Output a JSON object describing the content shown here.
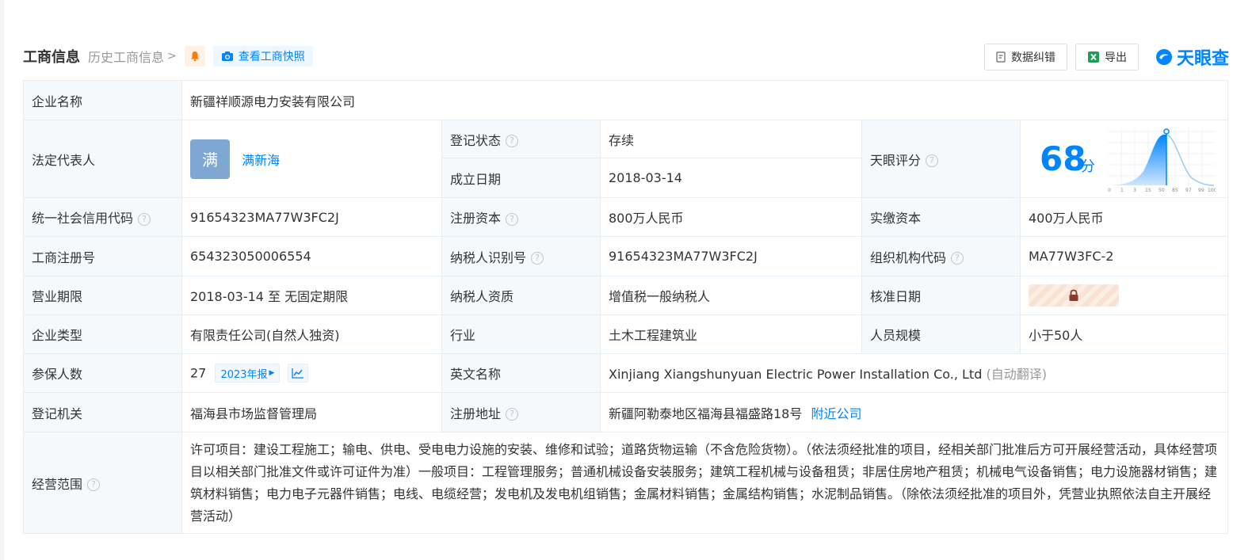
{
  "header": {
    "title": "工商信息",
    "history_label": "历史工商信息",
    "snapshot_label": "查看工商快照",
    "correct_label": "数据纠错",
    "export_label": "导出",
    "brand": "天眼查"
  },
  "rows": {
    "company_name": {
      "label": "企业名称",
      "value": "新疆祥顺源电力安装有限公司"
    },
    "legal_rep": {
      "label": "法定代表人",
      "avatar_char": "满",
      "name": "满新海"
    },
    "reg_status": {
      "label": "登记状态",
      "value": "存续"
    },
    "found_date": {
      "label": "成立日期",
      "value": "2018-03-14"
    },
    "tianyan_score": {
      "label": "天眼评分",
      "score": "68",
      "unit": "分",
      "value": 68,
      "axis_ticks": [
        "0",
        "1",
        "3",
        "15",
        "50",
        "85",
        "97",
        "99",
        "100"
      ]
    },
    "credit_code": {
      "label": "统一社会信用代码",
      "value": "91654323MA77W3FC2J"
    },
    "reg_capital": {
      "label": "注册资本",
      "value": "800万人民币"
    },
    "paid_capital": {
      "label": "实缴资本",
      "value": "400万人民币"
    },
    "reg_number": {
      "label": "工商注册号",
      "value": "654323050006554"
    },
    "taxpayer_id": {
      "label": "纳税人识别号",
      "value": "91654323MA77W3FC2J"
    },
    "org_code": {
      "label": "组织机构代码",
      "value": "MA77W3FC-2"
    },
    "term": {
      "label": "营业期限",
      "value": "2018-03-14 至 无固定期限"
    },
    "taxpayer_qual": {
      "label": "纳税人资质",
      "value": "增值税一般纳税人"
    },
    "approve_date": {
      "label": "核准日期"
    },
    "company_type": {
      "label": "企业类型",
      "value": "有限责任公司(自然人独资)"
    },
    "industry": {
      "label": "行业",
      "value": "土木工程建筑业"
    },
    "staff_size": {
      "label": "人员规模",
      "value": "小于50人"
    },
    "insured": {
      "label": "参保人数",
      "value": "27",
      "report": "2023年报"
    },
    "english_name": {
      "label": "英文名称",
      "value": "Xinjiang Xiangshunyuan Electric Power Installation Co., Ltd",
      "note": "(自动翻译)"
    },
    "authority": {
      "label": "登记机关",
      "value": "福海县市场监督管理局"
    },
    "reg_address": {
      "label": "注册地址",
      "value": "新疆阿勒泰地区福海县福盛路18号",
      "nearby": "附近公司"
    },
    "scope": {
      "label": "经营范围",
      "value": "许可项目：建设工程施工；输电、供电、受电电力设施的安装、维修和试验；道路货物运输（不含危险货物）。（依法须经批准的项目，经相关部门批准后方可开展经营活动，具体经营项目以相关部门批准文件或许可证件为准）一般项目：工程管理服务；普通机械设备安装服务；建筑工程机械与设备租赁；非居住房地产租赁；机械电气设备销售；电力设施器材销售；建筑材料销售；电力电子元器件销售；电线、电缆经营；发电机及发电机组销售；金属材料销售；金属结构销售；水泥制品销售。（除依法须经批准的项目外，凭营业执照依法自主开展经营活动）"
    }
  },
  "colors": {
    "accent": "#0084ff",
    "status_green": "#00a854",
    "label_bg": "#f5f9fc"
  }
}
